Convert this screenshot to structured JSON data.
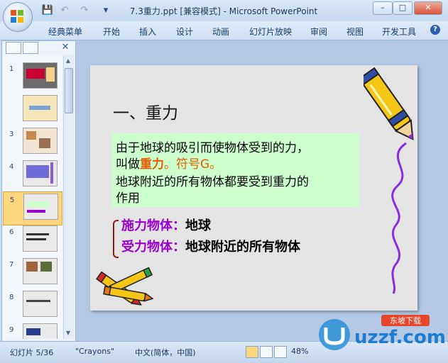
{
  "window": {
    "title": "7.3重力.ppt [兼容模式] - Microsoft PowerPoint",
    "controls": {
      "minimize": "–",
      "maximize": "□",
      "close": "✕"
    }
  },
  "qat": {
    "save_icon": "💾",
    "undo_icon": "↶",
    "redo_icon": "↷",
    "customize_icon": "▾"
  },
  "ribbon": {
    "tabs": [
      "经典菜单",
      "开始",
      "插入",
      "设计",
      "动画",
      "幻灯片放映",
      "审阅",
      "视图",
      "开发工具"
    ],
    "help": "?"
  },
  "panel": {
    "close": "✕",
    "slide_numbers": [
      "1",
      "2",
      "3",
      "4",
      "5",
      "6",
      "7",
      "8",
      "9"
    ],
    "selected": 5
  },
  "slide": {
    "title": "一、重力",
    "def_line1": "由于地球的吸引而使物体受到的力，",
    "def_line2_prefix": "叫做",
    "def_line2_bold": "重力",
    "def_line2_mid": "。",
    "def_line2_symbol": "符号G。",
    "def_line3": "地球附近的所有物体都要受到重力的",
    "def_line4": "作用",
    "applier_label": "施力物体：",
    "applier_value": "地球",
    "receiver_label": "受力物体：",
    "receiver_value": "地球附近的所有物体"
  },
  "status": {
    "slide_indicator": "幻灯片 5/36",
    "theme": "\"Crayons\"",
    "language": "中文(简体，中国)",
    "zoom": "48%"
  },
  "watermark": {
    "text": "uzzf.com",
    "subtext": "东坡下载"
  },
  "colors": {
    "accent_red": "#e65c00",
    "purple": "#9900cc",
    "green_box": "#ccffcc",
    "ribbon_text": "#15406d"
  }
}
